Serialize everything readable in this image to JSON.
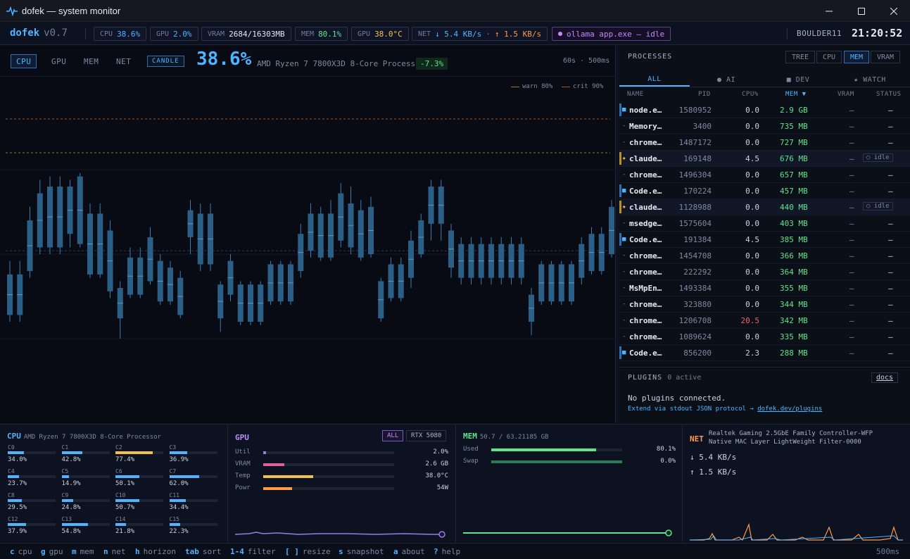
{
  "window": {
    "title": "dofek — system monitor"
  },
  "status": {
    "brand": "dofek",
    "version": "v0.7",
    "cpu": {
      "key": "CPU",
      "value": "38.6%"
    },
    "gpu": {
      "key": "GPU",
      "value": "2.0%"
    },
    "vram": {
      "key": "VRAM",
      "value": "2684/16303MB"
    },
    "mem": {
      "key": "MEM",
      "value": "80.1%"
    },
    "gputemp": {
      "key": "GPU",
      "value": "38.0°C"
    },
    "net": {
      "key": "NET",
      "down": "↓ 5.4 KB/s",
      "sep": "·",
      "up": "↑ 1.5 KB/s"
    },
    "ollama": "ollama app.exe — idle",
    "host": "BOULDER11",
    "clock": "21:20:52"
  },
  "chart": {
    "tabs": [
      "CPU",
      "GPU",
      "MEM",
      "NET"
    ],
    "active_tab": "CPU",
    "mode_button": "CANDLE",
    "value": "38.6%",
    "processor": "AMD Ryzen 7 7800X3D 8-Core Processor",
    "delta": "-7.3%",
    "rate": "60s · 500ms",
    "legend_warn": "warn 80%",
    "legend_crit": "crit 90%",
    "colors": {
      "candle": "#2b5f86",
      "wick": "#3c7cb0",
      "accent": "#4fb4ff",
      "warn": "#9a7a2a",
      "crit": "#9a5a2a"
    }
  },
  "chart_data": {
    "type": "candlestick",
    "ylim": [
      0,
      100
    ],
    "warn": 80,
    "crit": 90,
    "candles": [
      {
        "o": 44,
        "c": 32,
        "h": 48,
        "l": 30
      },
      {
        "o": 44,
        "c": 32,
        "h": 48,
        "l": 30
      },
      {
        "o": 60,
        "c": 45,
        "h": 64,
        "l": 43
      },
      {
        "o": 68,
        "c": 52,
        "h": 72,
        "l": 50
      },
      {
        "o": 70,
        "c": 52,
        "h": 73,
        "l": 50
      },
      {
        "o": 70,
        "c": 52,
        "h": 73,
        "l": 50
      },
      {
        "o": 70,
        "c": 56,
        "h": 72,
        "l": 52
      },
      {
        "o": 73,
        "c": 53,
        "h": 74,
        "l": 52
      },
      {
        "o": 62,
        "c": 44,
        "h": 65,
        "l": 43
      },
      {
        "o": 62,
        "c": 44,
        "h": 65,
        "l": 43
      },
      {
        "o": 57,
        "c": 39,
        "h": 60,
        "l": 37
      },
      {
        "o": 40,
        "c": 31,
        "h": 42,
        "l": 25
      },
      {
        "o": 49,
        "c": 38,
        "h": 52,
        "l": 37
      },
      {
        "o": 49,
        "c": 38,
        "h": 52,
        "l": 37
      },
      {
        "o": 55,
        "c": 42,
        "h": 58,
        "l": 41
      },
      {
        "o": 48,
        "c": 36,
        "h": 50,
        "l": 35
      },
      {
        "o": 46,
        "c": 36,
        "h": 48,
        "l": 35
      },
      {
        "o": 43,
        "c": 32,
        "h": 45,
        "l": 31
      },
      {
        "o": 63,
        "c": 55,
        "h": 66,
        "l": 50
      },
      {
        "o": 62,
        "c": 47,
        "h": 65,
        "l": 45
      },
      {
        "o": 62,
        "c": 47,
        "h": 65,
        "l": 45
      },
      {
        "o": 41,
        "c": 31,
        "h": 42,
        "l": 27
      },
      {
        "o": 48,
        "c": 38,
        "h": 50,
        "l": 36
      },
      {
        "o": 41,
        "c": 30,
        "h": 42,
        "l": 29
      },
      {
        "o": 41,
        "c": 30,
        "h": 42,
        "l": 29
      },
      {
        "o": 41,
        "c": 30,
        "h": 42,
        "l": 29
      },
      {
        "o": 47,
        "c": 36,
        "h": 48,
        "l": 35
      },
      {
        "o": 47,
        "c": 36,
        "h": 48,
        "l": 35
      },
      {
        "o": 47,
        "c": 36,
        "h": 48,
        "l": 35
      },
      {
        "o": 56,
        "c": 45,
        "h": 59,
        "l": 43
      },
      {
        "o": 62,
        "c": 51,
        "h": 65,
        "l": 49
      },
      {
        "o": 62,
        "c": 49,
        "h": 64,
        "l": 48
      },
      {
        "o": 62,
        "c": 49,
        "h": 66,
        "l": 48
      },
      {
        "o": 68,
        "c": 54,
        "h": 71,
        "l": 52
      },
      {
        "o": 65,
        "c": 52,
        "h": 70,
        "l": 50
      },
      {
        "o": 63,
        "c": 49,
        "h": 66,
        "l": 48
      },
      {
        "o": 64,
        "c": 50,
        "h": 67,
        "l": 49
      },
      {
        "o": 42,
        "c": 31,
        "h": 43,
        "l": 30
      },
      {
        "o": 47,
        "c": 37,
        "h": 49,
        "l": 36
      },
      {
        "o": 47,
        "c": 37,
        "h": 49,
        "l": 36
      },
      {
        "o": 54,
        "c": 43,
        "h": 57,
        "l": 40
      },
      {
        "o": 60,
        "c": 50,
        "h": 62,
        "l": 49
      },
      {
        "o": 70,
        "c": 59,
        "h": 72,
        "l": 54
      },
      {
        "o": 70,
        "c": 59,
        "h": 72,
        "l": 54
      },
      {
        "o": 57,
        "c": 46,
        "h": 59,
        "l": 43
      },
      {
        "o": 53,
        "c": 43,
        "h": 55,
        "l": 41
      },
      {
        "o": 53,
        "c": 43,
        "h": 55,
        "l": 41
      },
      {
        "o": 53,
        "c": 43,
        "h": 55,
        "l": 41
      },
      {
        "o": 53,
        "c": 43,
        "h": 55,
        "l": 41
      },
      {
        "o": 53,
        "c": 43,
        "h": 55,
        "l": 41
      },
      {
        "o": 53,
        "c": 43,
        "h": 55,
        "l": 41
      },
      {
        "o": 53,
        "c": 43,
        "h": 55,
        "l": 41
      },
      {
        "o": 38,
        "c": 30,
        "h": 40,
        "l": 26
      },
      {
        "o": 47,
        "c": 36,
        "h": 48,
        "l": 35
      },
      {
        "o": 47,
        "c": 36,
        "h": 48,
        "l": 35
      },
      {
        "o": 47,
        "c": 36,
        "h": 48,
        "l": 35
      },
      {
        "o": 47,
        "c": 36,
        "h": 48,
        "l": 35
      },
      {
        "o": 53,
        "c": 43,
        "h": 55,
        "l": 41
      },
      {
        "o": 56,
        "c": 45,
        "h": 58,
        "l": 44
      },
      {
        "o": 56,
        "c": 45,
        "h": 58,
        "l": 44
      },
      {
        "o": 64,
        "c": 50,
        "h": 66,
        "l": 49
      },
      {
        "o": 75,
        "c": 60,
        "h": 79,
        "l": 59
      },
      {
        "o": 75,
        "c": 60,
        "h": 79,
        "l": 59
      },
      {
        "o": 64,
        "c": 53,
        "h": 66,
        "l": 51
      },
      {
        "o": 71,
        "c": 57,
        "h": 73,
        "l": 56
      },
      {
        "o": 59,
        "c": 51,
        "h": 62,
        "l": 48
      }
    ]
  },
  "processes": {
    "title": "PROCESSES",
    "sort_buttons": [
      "TREE",
      "CPU",
      "MEM",
      "VRAM"
    ],
    "active_sort": "MEM",
    "filters": [
      "ALL",
      "● AI",
      "■ DEV",
      "★ WATCH"
    ],
    "active_filter": "ALL",
    "columns": [
      "NAME",
      "PID",
      "CPU%",
      "MEM ▼",
      "VRAM",
      "STATUS"
    ],
    "rows": [
      {
        "mark": "■",
        "mark_color": "#4fb4ff",
        "name": "node.e…",
        "pid": "1580952",
        "cpu": "0.0",
        "mem": "2.9 GB",
        "vram": "—",
        "status": "—"
      },
      {
        "mark": "-",
        "mark_color": "#6f7e96",
        "name": "Memory…",
        "pid": "3400",
        "cpu": "0.0",
        "mem": "735 MB",
        "vram": "—",
        "status": "—"
      },
      {
        "mark": "-",
        "mark_color": "#6f7e96",
        "name": "chrome…",
        "pid": "1487172",
        "cpu": "0.0",
        "mem": "727 MB",
        "vram": "—",
        "status": "—"
      },
      {
        "mark": "★",
        "mark_color": "#f2c14b",
        "name": "claude…",
        "pid": "169148",
        "cpu": "4.5",
        "mem": "676 MB",
        "vram": "—",
        "status": "○ idle"
      },
      {
        "mark": "-",
        "mark_color": "#6f7e96",
        "name": "chrome…",
        "pid": "1496304",
        "cpu": "0.0",
        "mem": "657 MB",
        "vram": "—",
        "status": "—"
      },
      {
        "mark": "■",
        "mark_color": "#4fb4ff",
        "name": "Code.e…",
        "pid": "170224",
        "cpu": "0.0",
        "mem": "457 MB",
        "vram": "—",
        "status": "—"
      },
      {
        "mark": "★",
        "mark_color": "#f2c14b",
        "name": "claude…",
        "pid": "1128988",
        "cpu": "0.0",
        "mem": "440 MB",
        "vram": "—",
        "status": "○ idle"
      },
      {
        "mark": "-",
        "mark_color": "#6f7e96",
        "name": "msedge…",
        "pid": "1575604",
        "cpu": "0.0",
        "mem": "403 MB",
        "vram": "—",
        "status": "—"
      },
      {
        "mark": "■",
        "mark_color": "#4fb4ff",
        "name": "Code.e…",
        "pid": "191384",
        "cpu": "4.5",
        "mem": "385 MB",
        "vram": "—",
        "status": "—"
      },
      {
        "mark": "-",
        "mark_color": "#6f7e96",
        "name": "chrome…",
        "pid": "1454708",
        "cpu": "0.0",
        "mem": "366 MB",
        "vram": "—",
        "status": "—"
      },
      {
        "mark": "-",
        "mark_color": "#6f7e96",
        "name": "chrome…",
        "pid": "222292",
        "cpu": "0.0",
        "mem": "364 MB",
        "vram": "—",
        "status": "—"
      },
      {
        "mark": "-",
        "mark_color": "#6f7e96",
        "name": "MsMpEn…",
        "pid": "1493384",
        "cpu": "0.0",
        "mem": "355 MB",
        "vram": "—",
        "status": "—"
      },
      {
        "mark": "-",
        "mark_color": "#6f7e96",
        "name": "chrome…",
        "pid": "323880",
        "cpu": "0.0",
        "mem": "344 MB",
        "vram": "—",
        "status": "—"
      },
      {
        "mark": "-",
        "mark_color": "#6f7e96",
        "name": "chrome…",
        "pid": "1206708",
        "cpu": "20.5",
        "mem": "342 MB",
        "vram": "—",
        "status": "—",
        "cpu_hot": true
      },
      {
        "mark": "-",
        "mark_color": "#6f7e96",
        "name": "chrome…",
        "pid": "1089624",
        "cpu": "0.0",
        "mem": "335 MB",
        "vram": "—",
        "status": "—"
      },
      {
        "mark": "■",
        "mark_color": "#4fb4ff",
        "name": "Code.e…",
        "pid": "856200",
        "cpu": "2.3",
        "mem": "288 MB",
        "vram": "—",
        "status": "—"
      }
    ]
  },
  "plugins": {
    "title": "PLUGINS",
    "count": "0 active",
    "docs": "docs",
    "message": "No plugins connected.",
    "extend_text": "Extend via stdout JSON protocol →",
    "extend_link": "dofek.dev/plugins"
  },
  "cpu_panel": {
    "title": "CPU",
    "subtitle": "AMD Ryzen 7 7800X3D 8-Core Processor",
    "cores": [
      {
        "name": "C0",
        "value": "34.0%",
        "pct": 34.0
      },
      {
        "name": "C1",
        "value": "42.8%",
        "pct": 42.8
      },
      {
        "name": "C2",
        "value": "77.4%",
        "pct": 77.4,
        "color": "#f2c14b"
      },
      {
        "name": "C3",
        "value": "36.9%",
        "pct": 36.9
      },
      {
        "name": "C4",
        "value": "23.7%",
        "pct": 23.7
      },
      {
        "name": "C5",
        "value": "14.9%",
        "pct": 14.9
      },
      {
        "name": "C6",
        "value": "50.1%",
        "pct": 50.1
      },
      {
        "name": "C7",
        "value": "62.0%",
        "pct": 62.0
      },
      {
        "name": "C8",
        "value": "29.5%",
        "pct": 29.5
      },
      {
        "name": "C9",
        "value": "24.8%",
        "pct": 24.8
      },
      {
        "name": "C10",
        "value": "50.7%",
        "pct": 50.7
      },
      {
        "name": "C11",
        "value": "34.4%",
        "pct": 34.4
      },
      {
        "name": "C12",
        "value": "37.9%",
        "pct": 37.9
      },
      {
        "name": "C13",
        "value": "54.8%",
        "pct": 54.8
      },
      {
        "name": "C14",
        "value": "21.8%",
        "pct": 21.8
      },
      {
        "name": "C15",
        "value": "22.3%",
        "pct": 22.3
      }
    ]
  },
  "gpu_panel": {
    "title": "GPU",
    "buttons": [
      "ALL",
      "RTX 5080"
    ],
    "rows": [
      {
        "key": "Util",
        "value": "2.0%",
        "pct": 2,
        "color": "#9a7ae8"
      },
      {
        "key": "VRAM",
        "value": "2.6 GB",
        "pct": 16,
        "color": "#e05fa0"
      },
      {
        "key": "Temp",
        "value": "38.0°C",
        "pct": 38,
        "color": "#f2c14b"
      },
      {
        "key": "Powr",
        "value": "54W",
        "pct": 22,
        "color": "#ff9a4a"
      }
    ]
  },
  "mem_panel": {
    "title": "MEM",
    "subtitle": "50.7 / 63.21185 GB",
    "rows": [
      {
        "key": "Used",
        "value": "80.1%",
        "pct": 80.1,
        "color": "#5fe38c"
      },
      {
        "key": "Swap",
        "value": "0.0%",
        "pct": 100,
        "color": "#2a7a55"
      }
    ]
  },
  "net_panel": {
    "title": "NET",
    "adapter1": "Realtek Gaming 2.5GbE Family Controller-WFP",
    "adapter2": "Native MAC Layer LightWeight Filter-0000",
    "down": "↓ 5.4 KB/s",
    "up": "↑ 1.5 KB/s"
  },
  "keybar": {
    "hints": [
      {
        "key": "c",
        "label": "cpu"
      },
      {
        "key": "g",
        "label": "gpu"
      },
      {
        "key": "m",
        "label": "mem"
      },
      {
        "key": "n",
        "label": "net"
      },
      {
        "key": "h",
        "label": "horizon"
      },
      {
        "key": "tab",
        "label": "sort"
      },
      {
        "key": "1-4",
        "label": "filter"
      },
      {
        "key": "[ ]",
        "label": "resize"
      },
      {
        "key": "s",
        "label": "snapshot"
      },
      {
        "key": "a",
        "label": "about"
      },
      {
        "key": "?",
        "label": "help"
      }
    ],
    "rate": "500ms"
  }
}
